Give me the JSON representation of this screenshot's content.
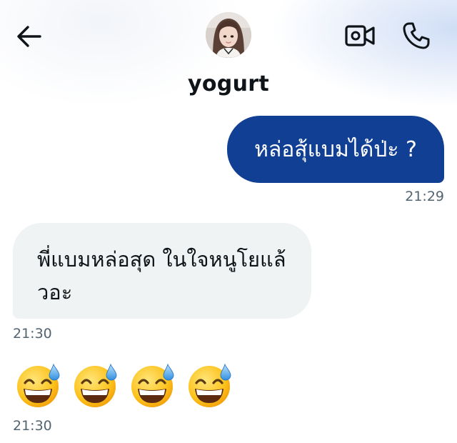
{
  "header": {
    "contact_name": "yogurt",
    "icons": {
      "back": "back-arrow-icon",
      "video": "video-camera-icon",
      "call": "phone-icon"
    }
  },
  "messages": [
    {
      "direction": "outgoing",
      "text": "หล่อสุ้แบมได้ป่ะ ?",
      "time": "21:29"
    },
    {
      "direction": "incoming",
      "text": "พี่แบมหล่อสุด ในใจหนูโยแล้วอะ",
      "time": "21:30"
    },
    {
      "direction": "incoming",
      "emoji": "grinning-face-with-sweat",
      "count": 4,
      "time": "21:30"
    }
  ],
  "colors": {
    "outgoing_bubble": "#103f93",
    "incoming_bubble": "#eff3f4",
    "timestamp": "#536471"
  }
}
